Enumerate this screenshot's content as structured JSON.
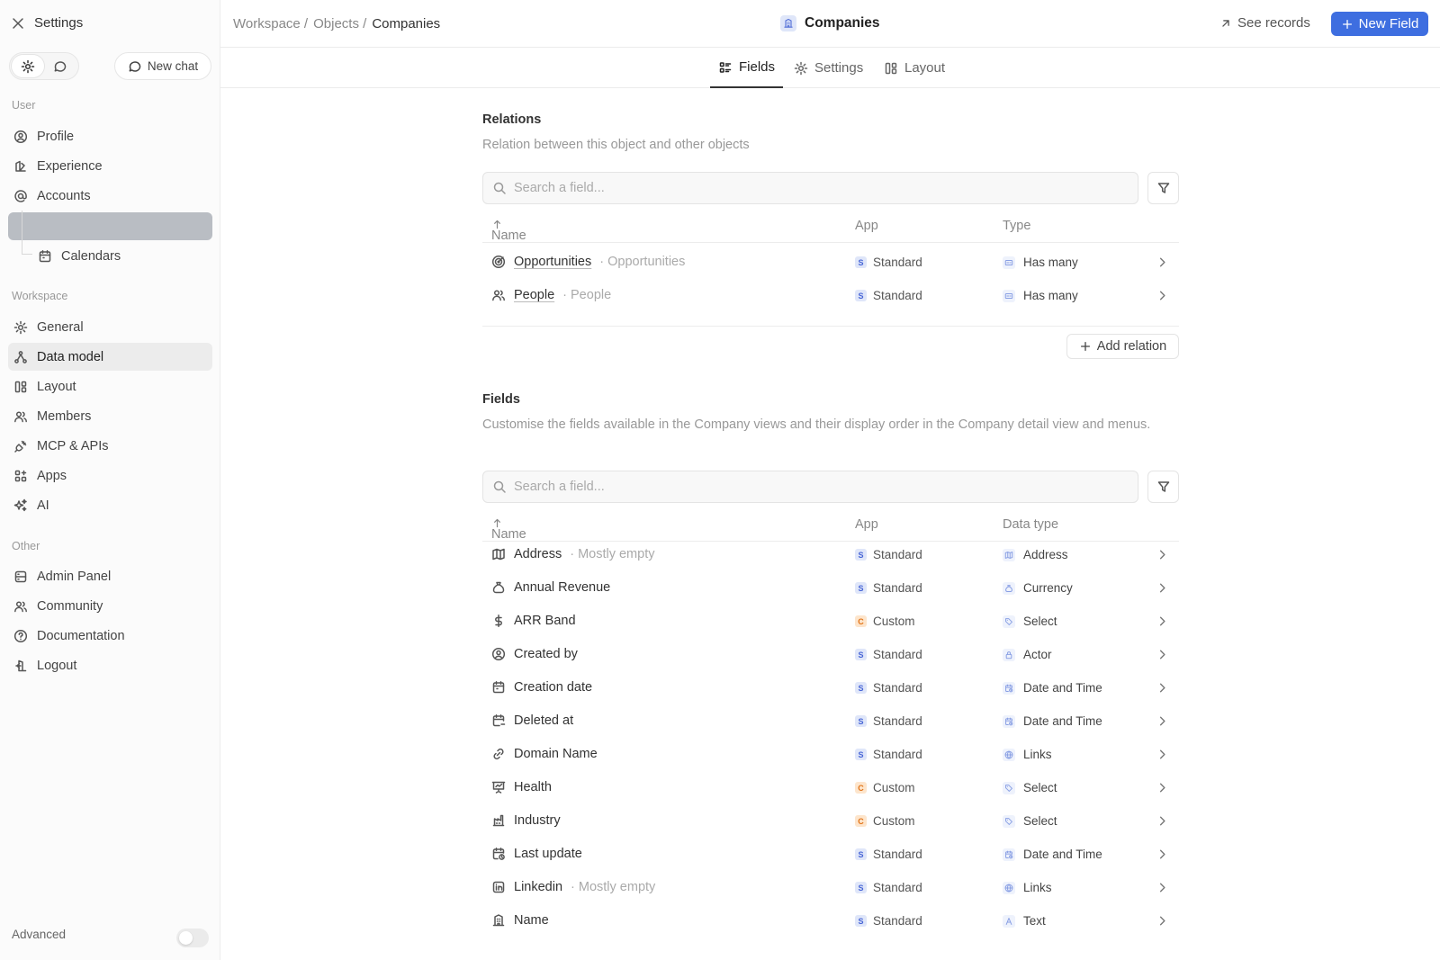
{
  "sidebar": {
    "title": "Settings",
    "new_chat": "New chat",
    "sections": {
      "user": "User",
      "workspace": "Workspace",
      "other": "Other"
    },
    "user_items": [
      {
        "label": "Profile",
        "icon": "user-circle-icon"
      },
      {
        "label": "Experience",
        "icon": "palette-icon"
      },
      {
        "label": "Accounts",
        "icon": "at-icon"
      }
    ],
    "sub_items": [
      {
        "label": "Calendars",
        "icon": "calendar-icon"
      }
    ],
    "workspace_items": [
      {
        "label": "General",
        "icon": "gear-icon"
      },
      {
        "label": "Data model",
        "icon": "hierarchy-icon"
      },
      {
        "label": "Layout",
        "icon": "layout-icon"
      },
      {
        "label": "Members",
        "icon": "users-icon"
      },
      {
        "label": "MCP & APIs",
        "icon": "plug-icon"
      },
      {
        "label": "Apps",
        "icon": "apps-icon"
      },
      {
        "label": "AI",
        "icon": "sparkles-icon"
      }
    ],
    "other_items": [
      {
        "label": "Admin Panel",
        "icon": "server-icon"
      },
      {
        "label": "Community",
        "icon": "users-icon"
      },
      {
        "label": "Documentation",
        "icon": "help-icon"
      },
      {
        "label": "Logout",
        "icon": "logout-icon"
      }
    ],
    "advanced": "Advanced",
    "active_item": "Data model"
  },
  "topbar": {
    "breadcrumbs": [
      "Workspace",
      "Objects",
      "Companies"
    ],
    "title": "Companies",
    "see_records": "See records",
    "new_field": "New Field"
  },
  "tabs": [
    {
      "label": "Fields",
      "icon": "list-icon",
      "active": true
    },
    {
      "label": "Settings",
      "icon": "gear-icon",
      "active": false
    },
    {
      "label": "Layout",
      "icon": "layout-icon",
      "active": false
    }
  ],
  "relations": {
    "title": "Relations",
    "description": "Relation between this object and other objects",
    "search_placeholder": "Search a field...",
    "columns": [
      "Name",
      "App",
      "Type"
    ],
    "rows": [
      {
        "name": "Opportunities",
        "secondary": "Opportunities",
        "icon": "target-icon",
        "app": "Standard",
        "app_code": "S",
        "type": "Has many"
      },
      {
        "name": "People",
        "secondary": "People",
        "icon": "users-icon",
        "app": "Standard",
        "app_code": "S",
        "type": "Has many"
      }
    ],
    "add_button": "Add relation"
  },
  "fields": {
    "title": "Fields",
    "description": "Customise the fields available in the Company views and their display order in the Company detail view and menus.",
    "search_placeholder": "Search a field...",
    "columns": [
      "Name",
      "App",
      "Data type"
    ],
    "rows": [
      {
        "name": "Address",
        "secondary": "Mostly empty",
        "icon": "map-icon",
        "app": "Standard",
        "app_code": "S",
        "type": "Address",
        "type_icon": "map-icon"
      },
      {
        "name": "Annual Revenue",
        "secondary": "",
        "icon": "money-bag-icon",
        "app": "Standard",
        "app_code": "S",
        "type": "Currency",
        "type_icon": "money-bag-icon"
      },
      {
        "name": "ARR Band",
        "secondary": "",
        "icon": "dollar-icon",
        "app": "Custom",
        "app_code": "C",
        "type": "Select",
        "type_icon": "tag-icon"
      },
      {
        "name": "Created by",
        "secondary": "",
        "icon": "user-circle-icon",
        "app": "Standard",
        "app_code": "S",
        "type": "Actor",
        "type_icon": "lock-icon"
      },
      {
        "name": "Creation date",
        "secondary": "",
        "icon": "calendar-icon",
        "app": "Standard",
        "app_code": "S",
        "type": "Date and Time",
        "type_icon": "calendar-clock-icon"
      },
      {
        "name": "Deleted at",
        "secondary": "",
        "icon": "calendar-minus-icon",
        "app": "Standard",
        "app_code": "S",
        "type": "Date and Time",
        "type_icon": "calendar-clock-icon"
      },
      {
        "name": "Domain Name",
        "secondary": "",
        "icon": "link-icon",
        "app": "Standard",
        "app_code": "S",
        "type": "Links",
        "type_icon": "globe-icon"
      },
      {
        "name": "Health",
        "secondary": "",
        "icon": "presentation-icon",
        "app": "Custom",
        "app_code": "C",
        "type": "Select",
        "type_icon": "tag-icon"
      },
      {
        "name": "Industry",
        "secondary": "",
        "icon": "factory-icon",
        "app": "Custom",
        "app_code": "C",
        "type": "Select",
        "type_icon": "tag-icon"
      },
      {
        "name": "Last update",
        "secondary": "",
        "icon": "calendar-clock-icon",
        "app": "Standard",
        "app_code": "S",
        "type": "Date and Time",
        "type_icon": "calendar-clock-icon"
      },
      {
        "name": "Linkedin",
        "secondary": "Mostly empty",
        "icon": "linkedin-icon",
        "app": "Standard",
        "app_code": "S",
        "type": "Links",
        "type_icon": "globe-icon"
      },
      {
        "name": "Name",
        "secondary": "",
        "icon": "building-icon",
        "app": "Standard",
        "app_code": "S",
        "type": "Text",
        "type_icon": "text-icon"
      }
    ]
  },
  "colors": {
    "accent": "#3e6ee0",
    "standard_badge": "#4765d6",
    "custom_badge": "#e27316"
  }
}
